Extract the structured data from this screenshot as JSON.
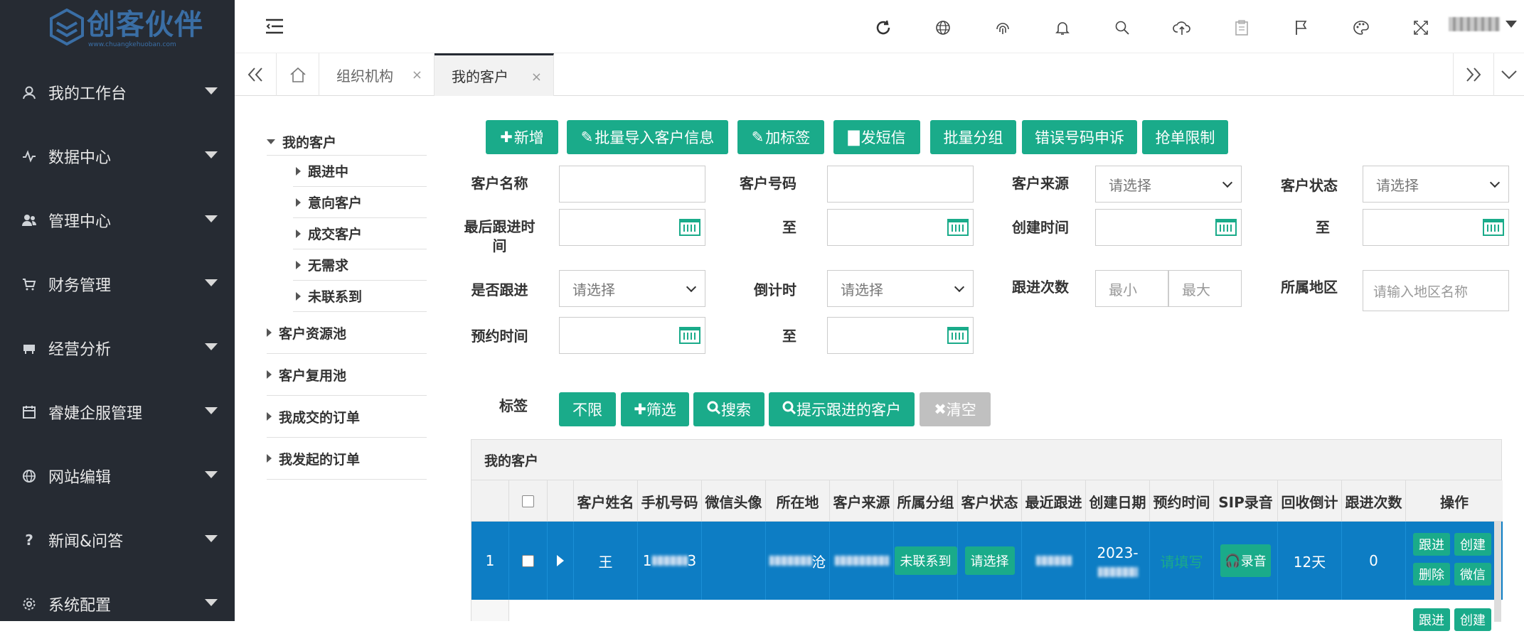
{
  "brand": {
    "name": "创客伙伴",
    "url_text": "www.chuangkehuoban.com",
    "color": "#3a6ea5"
  },
  "sidebar": {
    "items": [
      {
        "label": "我的工作台",
        "icon": "user-icon"
      },
      {
        "label": "数据中心",
        "icon": "pulse-icon"
      },
      {
        "label": "管理中心",
        "icon": "users-icon"
      },
      {
        "label": "财务管理",
        "icon": "cart-icon"
      },
      {
        "label": "经营分析",
        "icon": "bank-icon"
      },
      {
        "label": "睿婕企服管理",
        "icon": "calendar-icon"
      },
      {
        "label": "网站编辑",
        "icon": "globe-icon"
      },
      {
        "label": "新闻&问答",
        "icon": "question-icon"
      },
      {
        "label": "系统配置",
        "icon": "gear-icon"
      }
    ]
  },
  "topbar": {
    "icons": [
      "refresh-icon",
      "globe-icon",
      "fingerprint-icon",
      "bell-icon",
      "search-icon",
      "cloud-upload-icon",
      "clipboard-icon",
      "flag-icon",
      "palette-icon",
      "fullscreen-icon"
    ]
  },
  "tabs": {
    "items": [
      {
        "label": "组织机构",
        "close": "×"
      },
      {
        "label": "我的客户",
        "close": "×"
      }
    ]
  },
  "tree": {
    "root": "我的客户",
    "children": [
      "跟进中",
      "意向客户",
      "成交客户",
      "无需求",
      "未联系到"
    ],
    "others": [
      "客户资源池",
      "客户复用池",
      "我成交的订单",
      "我发起的订单"
    ]
  },
  "toolbar": {
    "add": "新增",
    "batch_import": "批量导入客户信息",
    "add_tag": "加标签",
    "send_sms": "发短信",
    "batch_group": "批量分组",
    "wrong_number": "错误号码申诉",
    "grab_limit": "抢单限制"
  },
  "filters": {
    "customer_name": "客户名称",
    "customer_phone": "客户号码",
    "customer_source": "客户来源",
    "customer_status": "客户状态",
    "last_follow": "最后跟进时间",
    "to": "至",
    "created_time": "创建时间",
    "is_follow": "是否跟进",
    "countdown": "倒计时",
    "follow_count": "跟进次数",
    "region": "所属地区",
    "appointment": "预约时间",
    "select_placeholder": "请选择",
    "min": "最小",
    "max": "最大",
    "region_placeholder": "请输入地区名称"
  },
  "tag_bar": {
    "label": "标签",
    "unlimited": "不限",
    "filter": "筛选",
    "search": "搜索",
    "prompt_follow": "提示跟进的客户",
    "clear": "清空"
  },
  "grid": {
    "title": "我的客户",
    "columns": [
      "客户姓名",
      "手机号码",
      "微信头像",
      "所在地",
      "客户来源",
      "所属分组",
      "客户状态",
      "最近跟进",
      "创建日期",
      "预约时间",
      "SIP录音",
      "回收倒计",
      "跟进次数",
      "操作"
    ],
    "row": {
      "index": "1",
      "name": "王",
      "phone_prefix": "1",
      "phone_suffix": "3",
      "location_suffix": "沧",
      "group": "未联系到",
      "status": "请选择",
      "created_prefix": "2023-",
      "appointment": "请填写",
      "sip": "录音",
      "recycle": "12天",
      "follow_count": "0",
      "actions": [
        "跟进",
        "创建",
        "删除",
        "微信"
      ]
    },
    "row2_actions": [
      "跟进",
      "创建"
    ]
  },
  "colors": {
    "primary": "#1aab8a",
    "sidebar": "#262b33",
    "selected_row": "#0d7dc4"
  }
}
